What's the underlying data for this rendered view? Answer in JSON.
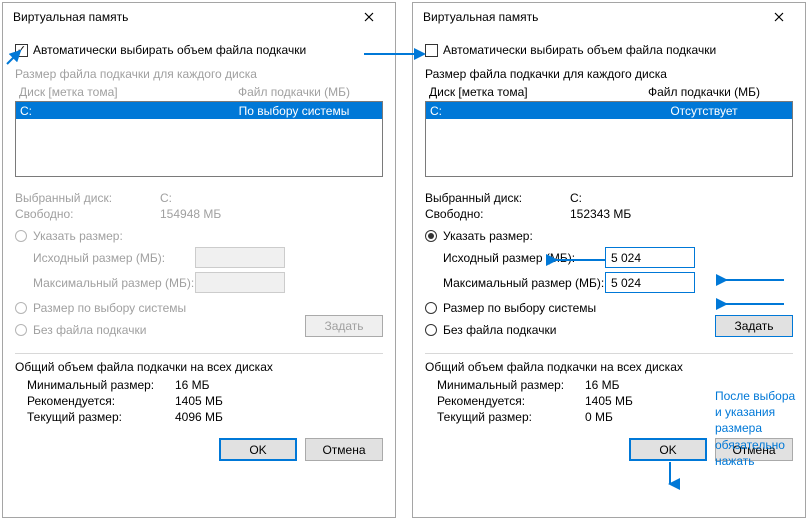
{
  "accent": "#0078d7",
  "left": {
    "title": "Виртуальная память",
    "auto_checked": true,
    "auto_label": "Автоматически выбирать объем файла подкачки",
    "drives_label": "Размер файла подкачки для каждого диска",
    "header_disk": "Диск [метка тома]",
    "header_page": "Файл подкачки (МБ)",
    "drive_row": {
      "disk": "C:",
      "page": "По выбору системы"
    },
    "selected_disk_label": "Выбранный диск:",
    "selected_disk_val": "C:",
    "free_label": "Свободно:",
    "free_val": "154948 МБ",
    "radio_custom": "Указать размер:",
    "initial_label": "Исходный размер (МБ):",
    "max_label": "Максимальный размер (МБ):",
    "radio_system": "Размер по выбору системы",
    "radio_none": "Без файла подкачки",
    "set_btn": "Задать",
    "totals_header": "Общий объем файла подкачки на всех дисках",
    "min_label": "Минимальный размер:",
    "min_val": "16 МБ",
    "rec_label": "Рекомендуется:",
    "rec_val": "1405 МБ",
    "cur_label": "Текущий размер:",
    "cur_val": "4096 МБ",
    "ok": "OK",
    "cancel": "Отмена"
  },
  "right": {
    "title": "Виртуальная память",
    "auto_checked": false,
    "auto_label": "Автоматически выбирать объем файла подкачки",
    "drives_label": "Размер файла подкачки для каждого диска",
    "header_disk": "Диск [метка тома]",
    "header_page": "Файл подкачки (МБ)",
    "drive_row": {
      "disk": "C:",
      "page": "Отсутствует"
    },
    "selected_disk_label": "Выбранный диск:",
    "selected_disk_val": "C:",
    "free_label": "Свободно:",
    "free_val": "152343 МБ",
    "radio_custom": "Указать размер:",
    "initial_label": "Исходный размер (МБ):",
    "initial_val": "5 024",
    "max_label": "Максимальный размер (МБ):",
    "max_val": "5 024",
    "radio_system": "Размер по выбору системы",
    "radio_none": "Без файла подкачки",
    "set_btn": "Задать",
    "totals_header": "Общий объем файла подкачки на всех дисках",
    "min_label": "Минимальный размер:",
    "min_val": "16 МБ",
    "rec_label": "Рекомендуется:",
    "rec_val": "1405 МБ",
    "cur_label": "Текущий размер:",
    "cur_val": "0 МБ",
    "ok": "OK",
    "cancel": "Отмена"
  },
  "note": {
    "line1": "После выбора",
    "line2": "и указания",
    "line3": "размера",
    "line4": "обязательно",
    "line5": "нажать"
  }
}
